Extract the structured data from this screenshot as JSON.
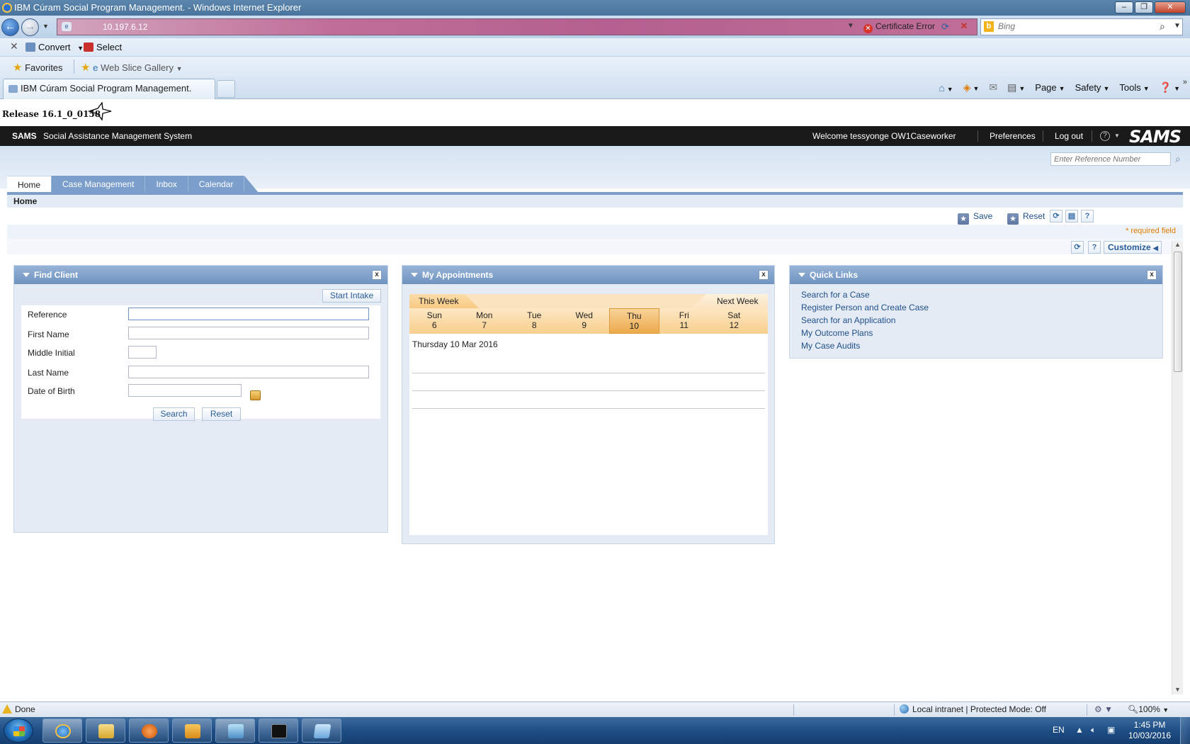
{
  "window": {
    "title": "IBM Cúram Social Program Management. - Windows Internet Explorer",
    "controls": [
      "–",
      "❐",
      "✕"
    ]
  },
  "address": {
    "url": "10.197.6.12",
    "cert_error": "Certificate Error",
    "search_placeholder": "Bing"
  },
  "commandbar": {
    "close": "✕",
    "convert": "Convert",
    "select": "Select"
  },
  "favbar": {
    "favorites": "Favorites",
    "web_slice": "Web Slice Gallery"
  },
  "tabs": {
    "active_title": "IBM Cúram Social Program Management.",
    "tools": {
      "page": "Page",
      "safety": "Safety",
      "tools": "Tools"
    }
  },
  "app": {
    "release": "Release 16.1_0_0158",
    "short_name": "SAMS",
    "full_name": "Social Assistance Management System",
    "welcome": "Welcome tessyonge OW1Caseworker",
    "preferences": "Preferences",
    "logout": "Log out",
    "logo": "SAMS",
    "ref_placeholder": "Enter Reference Number",
    "nav_tabs": [
      "Home",
      "Case Management",
      "Inbox",
      "Calendar"
    ],
    "page_title": "Home",
    "save": "Save",
    "reset": "Reset",
    "required_note": "* required field",
    "customize": "Customize"
  },
  "find_client": {
    "title": "Find Client",
    "start_intake": "Start Intake",
    "labels": {
      "reference": "Reference",
      "first_name": "First Name",
      "middle_initial": "Middle Initial",
      "last_name": "Last Name",
      "dob": "Date of Birth"
    },
    "values": {
      "reference": "",
      "first_name": "",
      "middle_initial": "",
      "last_name": "",
      "dob": ""
    },
    "search": "Search",
    "reset": "Reset"
  },
  "appointments": {
    "title": "My Appointments",
    "this_week": "This Week",
    "next_week": "Next Week",
    "days": [
      {
        "name": "Sun",
        "num": "6"
      },
      {
        "name": "Mon",
        "num": "7"
      },
      {
        "name": "Tue",
        "num": "8"
      },
      {
        "name": "Wed",
        "num": "9"
      },
      {
        "name": "Thu",
        "num": "10"
      },
      {
        "name": "Fri",
        "num": "11"
      },
      {
        "name": "Sat",
        "num": "12"
      }
    ],
    "selected_date": "Thursday 10 Mar 2016"
  },
  "quick_links": {
    "title": "Quick Links",
    "links": [
      "Search for a Case",
      "Register Person and Create Case",
      "Search for an Application",
      "My Outcome Plans",
      "My Case Audits"
    ]
  },
  "statusbar": {
    "status": "Done",
    "zone": "Local intranet | Protected Mode: Off",
    "zoom": "100%"
  },
  "taskbar": {
    "language": "EN",
    "time": "1:45 PM",
    "date": "10/03/2016"
  }
}
